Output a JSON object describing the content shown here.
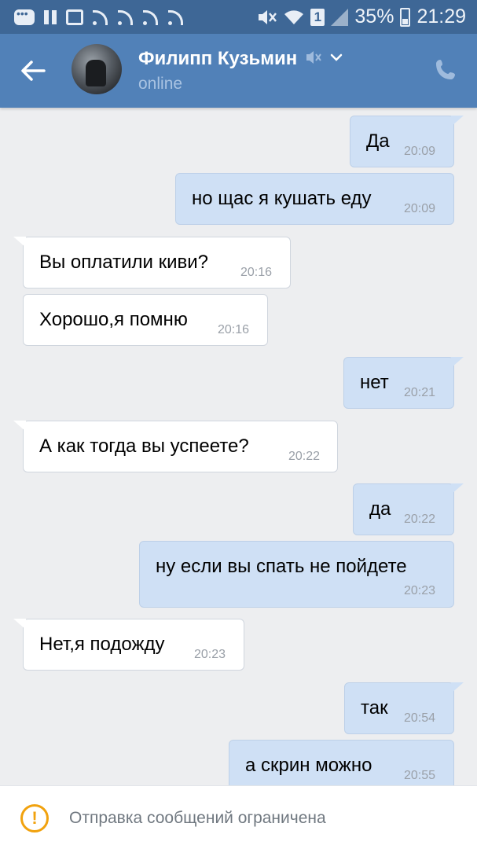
{
  "status_bar": {
    "battery": "35%",
    "time": "21:29",
    "sim": "1",
    "icons": [
      "chat-bubble-icon",
      "pause-icon",
      "gallery-icon",
      "feed-icon",
      "feed-icon",
      "feed-icon",
      "feed-icon",
      "mute-icon",
      "wifi-icon",
      "sim-icon",
      "signal-icon",
      "battery-icon"
    ]
  },
  "header": {
    "name": "Филипп Кузьмин",
    "status": "online",
    "icons": [
      "back-arrow-icon",
      "avatar",
      "muted-icon",
      "chevron-down-icon",
      "phone-icon"
    ]
  },
  "messages": [
    {
      "dir": "out",
      "text": "Да",
      "time": "20:09"
    },
    {
      "dir": "out",
      "text": "но щас я кушать еду",
      "time": "20:09"
    },
    {
      "dir": "in",
      "text": "Вы оплатили киви?",
      "time": "20:16"
    },
    {
      "dir": "in",
      "text": "Хорошо,я помню",
      "time": "20:16"
    },
    {
      "dir": "out",
      "text": "нет",
      "time": "20:21"
    },
    {
      "dir": "in",
      "text": "А как тогда вы успеете?",
      "time": "20:22"
    },
    {
      "dir": "out",
      "text": "да",
      "time": "20:22"
    },
    {
      "dir": "out",
      "text": "ну если вы спать не пойдете",
      "time": "20:23"
    },
    {
      "dir": "in",
      "text": "Нет,я подожду",
      "time": "20:23"
    },
    {
      "dir": "out",
      "text": "так",
      "time": "20:54"
    },
    {
      "dir": "out",
      "text": "а скрин можно",
      "time": "20:55"
    }
  ],
  "bottom": {
    "text": "Отправка сообщений ограничена",
    "icon": "warning-icon"
  },
  "colors": {
    "status_bar": "#3e6796",
    "header": "#5181b8",
    "background": "#edeef0",
    "outgoing_bubble": "#cfe0f5",
    "incoming_bubble": "#ffffff",
    "warning": "#f1a20e"
  }
}
